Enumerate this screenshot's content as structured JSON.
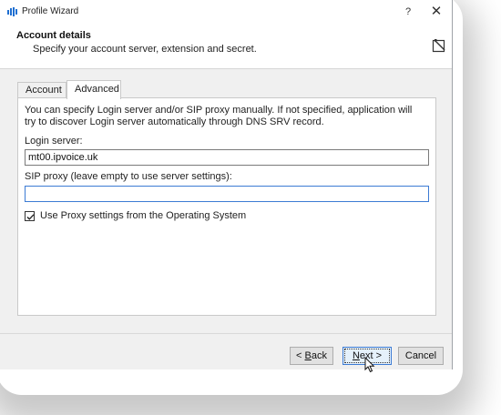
{
  "window": {
    "title": "Profile Wizard",
    "help_glyph": "?",
    "close_glyph": "✕"
  },
  "header": {
    "title": "Account details",
    "subtitle": "Specify your account server, extension and secret."
  },
  "tabs": [
    {
      "label": "Account",
      "selected": false
    },
    {
      "label": "Advanced",
      "selected": true
    }
  ],
  "advanced": {
    "info": "You can specify Login server and/or SIP proxy manually. If not specified, application will try to discover Login server automatically through DNS SRV record.",
    "login_server_label": "Login server:",
    "login_server_value": "mt00.ipvoice.uk",
    "sip_proxy_label": "SIP proxy (leave empty to use server settings):",
    "sip_proxy_value": "",
    "use_proxy_label": "Use Proxy settings from the Operating System",
    "use_proxy_checked": true
  },
  "buttons": {
    "back": {
      "prefix": "< ",
      "mnemonic": "B",
      "rest": "ack"
    },
    "next": {
      "prefix": "",
      "mnemonic": "N",
      "rest": "ext >"
    },
    "cancel": "Cancel"
  },
  "colors": {
    "accent": "#3c7bd4",
    "app_icon": "#1f6fd1"
  },
  "icons": {
    "app": "phone-app-icon",
    "header": "wizard-edit-icon",
    "cursor": "mouse-pointer-icon"
  }
}
